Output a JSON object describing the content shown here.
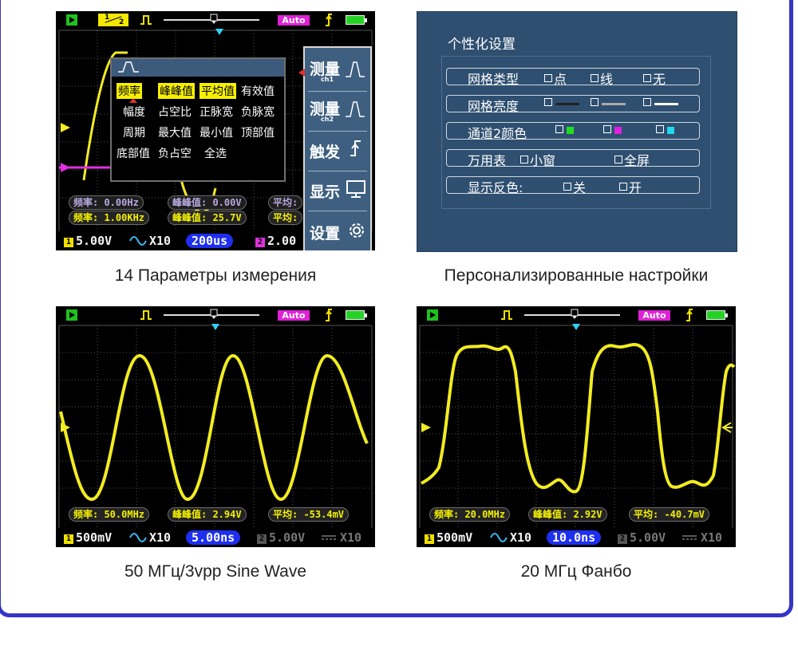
{
  "panels": {
    "p1": {
      "caption": "14 Параметры измерения",
      "status": {
        "mode": "Auto"
      },
      "menu": {
        "items": [
          "频率",
          "峰峰值",
          "平均值",
          "有效值",
          "幅度",
          "占空比",
          "正脉宽",
          "负脉宽",
          "周期",
          "最大值",
          "最小值",
          "顶部值",
          "底部值",
          "负占空",
          "全选"
        ]
      },
      "side_menu": [
        {
          "label": "测量",
          "sub": "ch1"
        },
        {
          "label": "测量",
          "sub": "ch2"
        },
        {
          "label": "触发",
          "sub": ""
        },
        {
          "label": "显示",
          "sub": ""
        },
        {
          "label": "设置",
          "sub": ""
        }
      ],
      "meas_ch2": [
        "频率: 0.00Hz",
        "峰峰值: 0.00V",
        "平均:"
      ],
      "meas_ch1": [
        "频率: 1.00KHz",
        "峰峰值: 25.7V",
        "平均:"
      ],
      "bottom": {
        "ch1": "1",
        "ch1_volt": "5.00V",
        "probe": "X10",
        "timebase": "200us",
        "ch2": "2",
        "ch2_volt": "2.00"
      },
      "ratio_top": "1",
      "ratio_bottom": "2"
    },
    "p2": {
      "caption": "Персонализированные настройки",
      "title": "个性化设置",
      "rows": [
        {
          "label": "网格类型",
          "options": [
            "点",
            "线",
            "无"
          ]
        },
        {
          "label": "网格亮度",
          "options": [
            "",
            "",
            ""
          ]
        },
        {
          "label": "通道2颜色",
          "options": [
            "",
            "",
            ""
          ]
        },
        {
          "label": "万用表",
          "options": [
            "小窗",
            "全屏"
          ]
        },
        {
          "label": "显示反色:",
          "options": [
            "关",
            "开"
          ]
        }
      ],
      "colors": {
        "bg": "#2e4f70",
        "green": "#22dd22",
        "magenta": "#e020e0",
        "cyan": "#20d8f0"
      }
    },
    "p3": {
      "caption": "50 МГц/3vpp Sine Wave",
      "status": {
        "mode": "Auto"
      },
      "meas": [
        "频率: 50.0MHz",
        "峰峰值: 2.94V",
        "平均: -53.4mV"
      ],
      "bottom": {
        "ch1": "1",
        "ch1_volt": "500mV",
        "probe": "X10",
        "timebase": "5.00ns",
        "ch2": "2",
        "ch2_volt": "5.00V",
        "ch2_probe": "X10"
      }
    },
    "p4": {
      "caption": "20 МГц Фанбо",
      "status": {
        "mode": "Auto"
      },
      "meas": [
        "频率: 20.0MHz",
        "峰峰值: 2.92V",
        "平均: -40.7mV"
      ],
      "bottom": {
        "ch1": "1",
        "ch1_volt": "500mV",
        "probe": "X10",
        "timebase": "10.0ns",
        "ch2": "2",
        "ch2_volt": "5.00V",
        "ch2_probe": "X10"
      }
    }
  },
  "colors": {
    "frame": "#3535c8",
    "trace": "#f2ec20",
    "ch2_trace": "#e030e0",
    "grid": "#5a5a5a"
  }
}
